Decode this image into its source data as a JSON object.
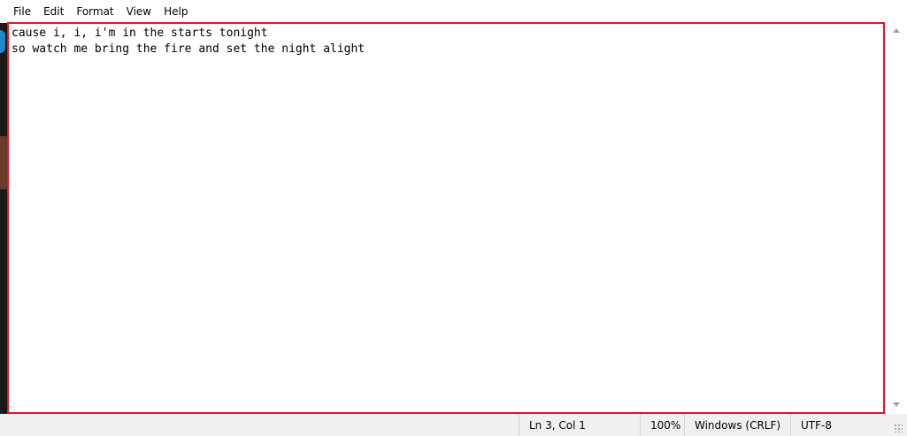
{
  "menubar": {
    "items": [
      {
        "label": "File"
      },
      {
        "label": "Edit"
      },
      {
        "label": "Format"
      },
      {
        "label": "View"
      },
      {
        "label": "Help"
      }
    ]
  },
  "editor": {
    "text": "cause i, i, i'm in the starts tonight\nso watch me bring the fire and set the night alight"
  },
  "statusbar": {
    "cursor_position": "Ln 3, Col 1",
    "zoom": "100%",
    "line_ending": "Windows (CRLF)",
    "encoding": "UTF-8"
  },
  "colors": {
    "highlight_border": "#e81123",
    "statusbar_bg": "#f0f0f0"
  },
  "icons": {
    "resize": "resize-grip-icon",
    "scroll_up": "scroll-up-arrow-icon",
    "scroll_down": "scroll-down-arrow-icon"
  }
}
